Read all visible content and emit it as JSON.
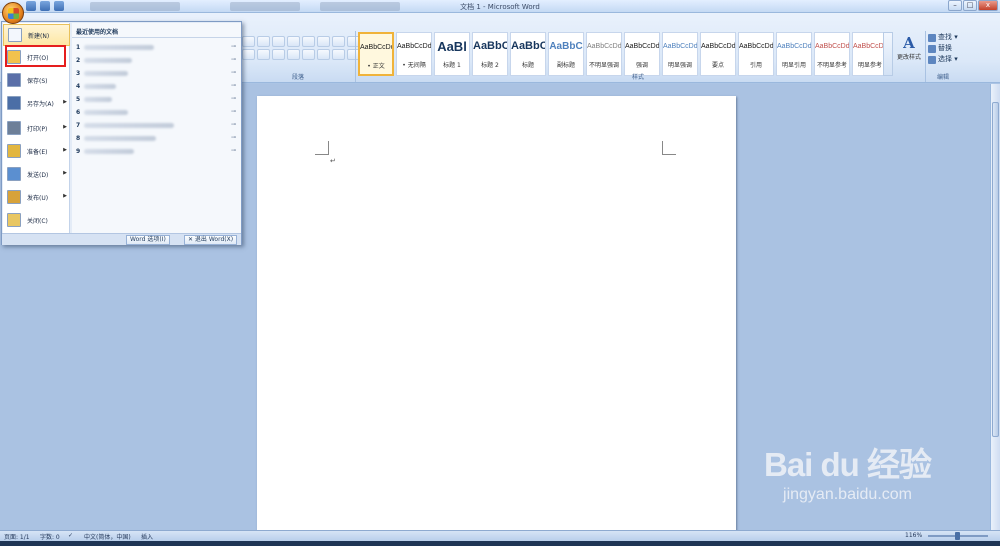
{
  "window": {
    "title": "文档 1 - Microsoft Word",
    "minimize": "–",
    "restore": "□",
    "close": "x"
  },
  "office_menu": {
    "items": [
      {
        "label": "新建(N)",
        "color": "#f3f7fd",
        "has_arrow": false
      },
      {
        "label": "打开(O)",
        "color": "#f2c24d",
        "has_arrow": false
      },
      {
        "label": "保存(S)",
        "color": "#5a6fa8",
        "has_arrow": false
      },
      {
        "label": "另存为(A)",
        "color": "#4b6ea6",
        "has_arrow": true
      },
      {
        "label": "打印(P)",
        "color": "#6d7f98",
        "has_arrow": true
      },
      {
        "label": "准备(E)",
        "color": "#e2b63f",
        "has_arrow": true
      },
      {
        "label": "发送(D)",
        "color": "#5b8fd0",
        "has_arrow": true
      },
      {
        "label": "发布(U)",
        "color": "#d7a23a",
        "has_arrow": true
      },
      {
        "label": "关闭(C)",
        "color": "#e8c662",
        "has_arrow": false
      }
    ],
    "recent_title": "最近使用的文档",
    "recent": [
      {
        "num": "1"
      },
      {
        "num": "2"
      },
      {
        "num": "3"
      },
      {
        "num": "4"
      },
      {
        "num": "5"
      },
      {
        "num": "6"
      },
      {
        "num": "7"
      },
      {
        "num": "8"
      },
      {
        "num": "9"
      }
    ],
    "options_button": "Word 选项(I)",
    "exit_button": "✕ 退出 Word(X)"
  },
  "ribbon": {
    "paragraph_label": "段落",
    "styles_label": "样式",
    "editing_label": "编辑",
    "styles": [
      {
        "sample": "AaBbCcDd",
        "name": "• 正文",
        "selected": true
      },
      {
        "sample": "AaBbCcDd",
        "name": "• 无间隔",
        "selected": false
      },
      {
        "sample": "AaBl",
        "name": "标题 1",
        "selected": false
      },
      {
        "sample": "AaBbC",
        "name": "标题 2",
        "selected": false
      },
      {
        "sample": "AaBbC",
        "name": "标题",
        "selected": false
      },
      {
        "sample": "AaBbC",
        "name": "副标题",
        "selected": false
      },
      {
        "sample": "AaBbCcDd",
        "name": "不明显强调",
        "selected": false
      },
      {
        "sample": "AaBbCcDd",
        "name": "强调",
        "selected": false
      },
      {
        "sample": "AaBbCcDd",
        "name": "明显强调",
        "selected": false
      },
      {
        "sample": "AaBbCcDd",
        "name": "要点",
        "selected": false
      },
      {
        "sample": "AaBbCcDd",
        "name": "引用",
        "selected": false
      },
      {
        "sample": "AaBbCcDd",
        "name": "明显引用",
        "selected": false
      },
      {
        "sample": "AaBbCcDd",
        "name": "不明显参考",
        "selected": false
      },
      {
        "sample": "AaBbCcDd",
        "name": "明显参考",
        "selected": false
      }
    ],
    "change_styles": "更改样式",
    "find": "查找 ▾",
    "replace": "替换",
    "select": "选择 ▾"
  },
  "document": {
    "paragraph_mark": "↵"
  },
  "statusbar": {
    "page": "页面: 1/1",
    "words": "字数: 0",
    "language": "中文(简体，中国)",
    "mode": "插入",
    "zoom": "116%"
  },
  "watermark": {
    "logo": "Bai du 经验",
    "url": "jingyan.baidu.com"
  }
}
